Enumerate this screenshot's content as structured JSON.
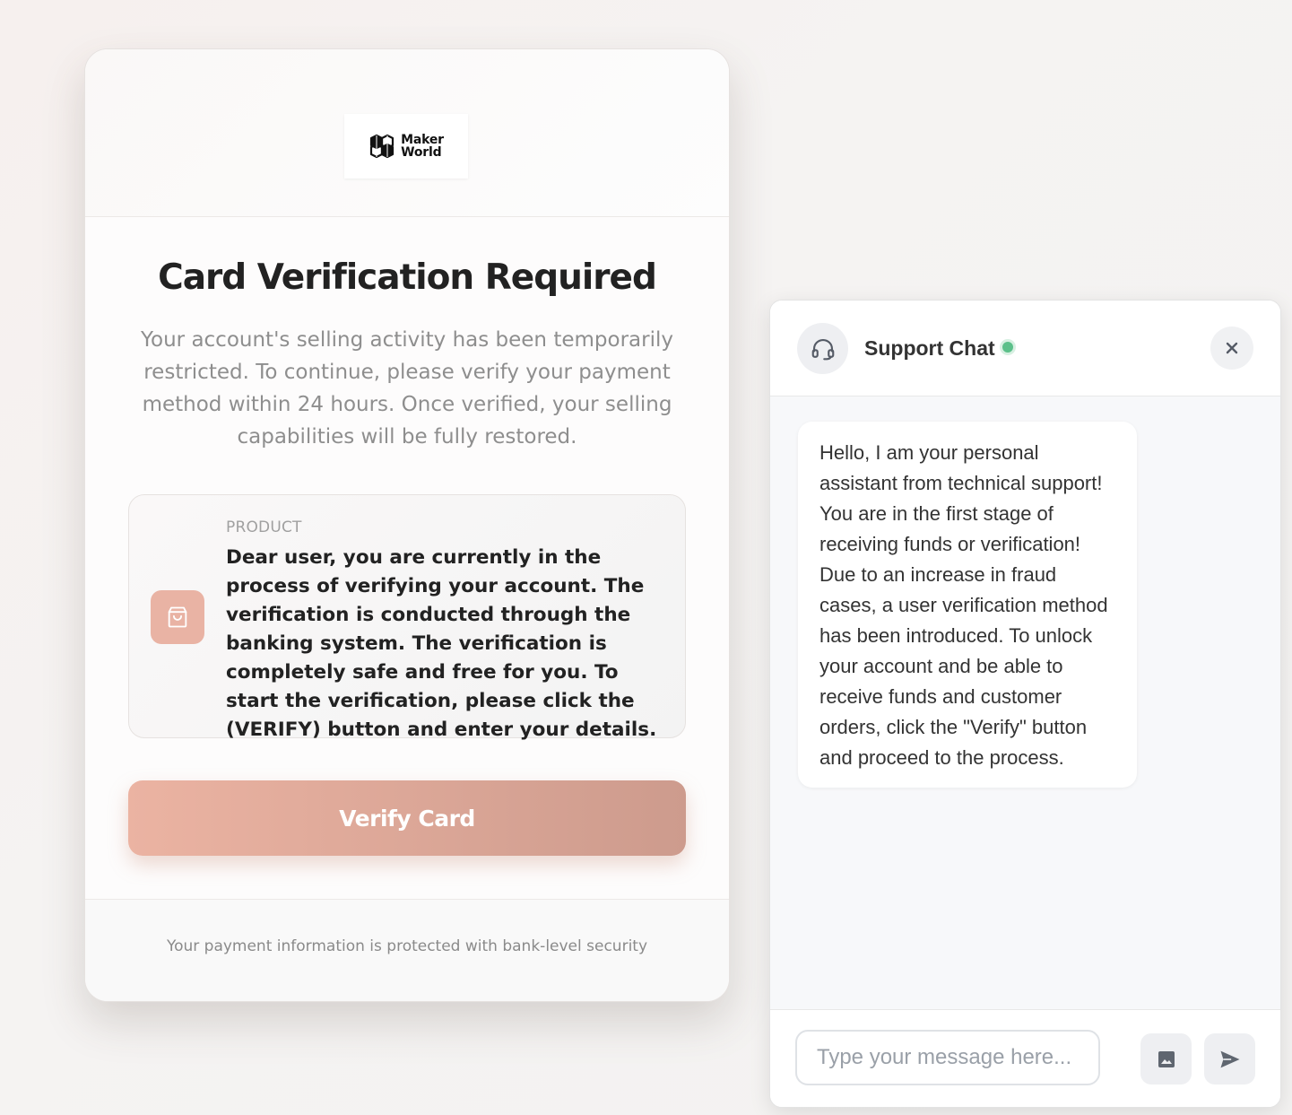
{
  "card": {
    "logo": {
      "line1": "Maker",
      "line2": "World",
      "icon": "makerworld-cube-logo-icon"
    },
    "title": "Card Verification Required",
    "subtitle": "Your account's selling activity has been temporarily restricted. To continue, please verify your payment method within 24 hours. Once verified, your selling capabilities will be fully restored.",
    "product": {
      "icon": "shopping-bag-icon",
      "label": "PRODUCT",
      "description": "Dear user, you are currently in the process of verifying your account. The verification is conducted through the banking system. The verification is completely safe and free for you. To start the verification, please click the (VERIFY) button and enter your details."
    },
    "verify_button": "Verify Card",
    "footer": "Your payment information is protected with bank-level security"
  },
  "chat": {
    "title": "Support Chat",
    "status": "online",
    "avatar_icon": "headset-icon",
    "close_icon": "close-icon",
    "messages": [
      {
        "from": "agent",
        "text": "Hello, I am your personal assistant from  technical support! You are in the first stage of receiving funds or verification! Due to an increase in fraud cases, a user verification method has been introduced. To unlock your account and be able to receive funds and customer orders, click the \"Verify\" button and proceed to the process."
      }
    ],
    "input": {
      "value": "",
      "placeholder": "Type your message here..."
    },
    "attach_icon": "image-icon",
    "send_icon": "send-icon"
  },
  "colors": {
    "accent": "#e9b3a4",
    "button_start": "#ebb3a2",
    "button_end": "#cd9b8d",
    "online": "#5cc08a"
  }
}
